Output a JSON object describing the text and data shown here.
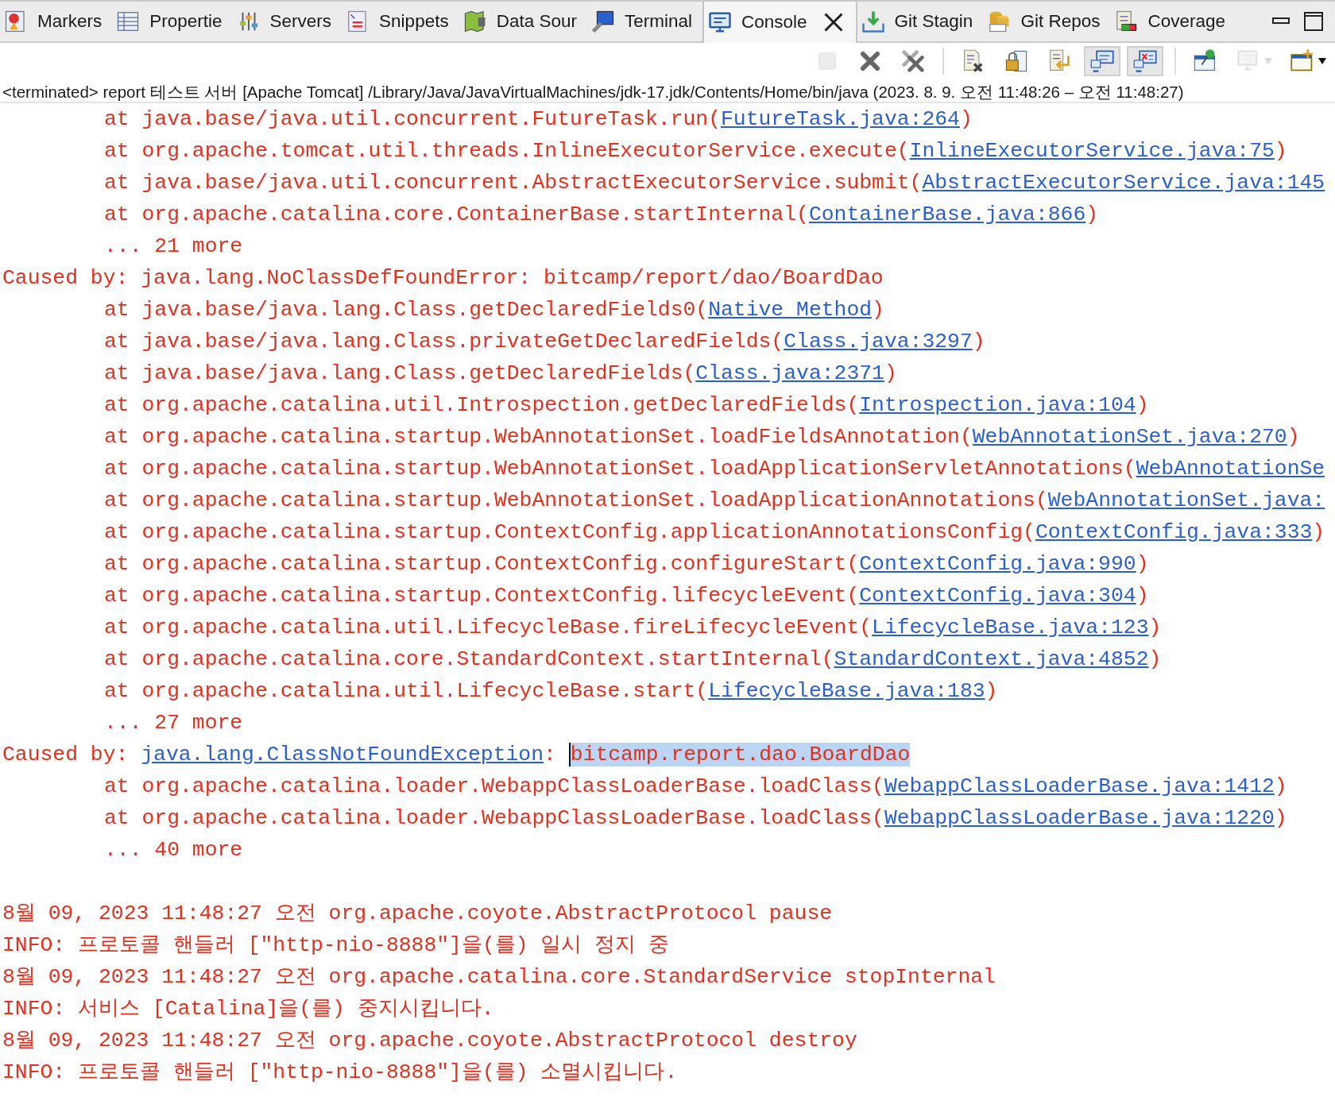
{
  "tabs": [
    {
      "label": "Markers",
      "kind": "markers",
      "selected": false,
      "closable": false
    },
    {
      "label": "Propertie",
      "kind": "table",
      "selected": false,
      "closable": false
    },
    {
      "label": "Servers",
      "kind": "sliders",
      "selected": false,
      "closable": false
    },
    {
      "label": "Snippets",
      "kind": "snippets",
      "selected": false,
      "closable": false
    },
    {
      "label": "Data Sour",
      "kind": "map",
      "selected": false,
      "closable": false
    },
    {
      "label": "Terminal",
      "kind": "terminal",
      "selected": false,
      "closable": false
    },
    {
      "label": "Console",
      "kind": "monitor",
      "selected": true,
      "closable": true
    },
    {
      "label": "Git Stagin",
      "kind": "staging",
      "selected": false,
      "closable": false
    },
    {
      "label": "Git Repos",
      "kind": "repos",
      "selected": false,
      "closable": false
    },
    {
      "label": "Coverage",
      "kind": "coverage",
      "selected": false,
      "closable": false
    }
  ],
  "toolbar": [
    {
      "kind": "stop",
      "disabled": true,
      "pressed": false,
      "menu": false
    },
    {
      "kind": "remove",
      "disabled": false,
      "pressed": false,
      "menu": false
    },
    {
      "kind": "remove-all",
      "disabled": false,
      "pressed": false,
      "menu": false
    },
    {
      "kind": "separator"
    },
    {
      "kind": "clear",
      "disabled": false,
      "pressed": false,
      "menu": false
    },
    {
      "kind": "scroll-lock",
      "disabled": false,
      "pressed": false,
      "menu": false
    },
    {
      "kind": "word-wrap",
      "disabled": false,
      "pressed": false,
      "menu": false
    },
    {
      "kind": "show-stdout",
      "disabled": false,
      "pressed": true,
      "menu": false
    },
    {
      "kind": "show-stderr",
      "disabled": false,
      "pressed": true,
      "menu": false
    },
    {
      "kind": "separator"
    },
    {
      "kind": "pin",
      "disabled": false,
      "pressed": false,
      "menu": false
    },
    {
      "kind": "display",
      "disabled": true,
      "pressed": false,
      "menu": true
    },
    {
      "kind": "new-console",
      "disabled": false,
      "pressed": false,
      "menu": true
    }
  ],
  "process_label": "<terminated> report 테스트 서버 [Apache Tomcat] /Library/Java/JavaVirtualMachines/jdk-17.jdk/Contents/Home/bin/java  (2023. 8. 9. 오전 11:48:26 – 오전 11:48:27)",
  "console_lines": [
    {
      "kind": "frame",
      "segments": [
        {
          "kind": "text",
          "text": "at java.base/java.util.concurrent.FutureTask.run("
        },
        {
          "kind": "link",
          "text": "FutureTask.java:264"
        },
        {
          "kind": "text",
          "text": ")"
        }
      ]
    },
    {
      "kind": "frame",
      "segments": [
        {
          "kind": "text",
          "text": "at org.apache.tomcat.util.threads.InlineExecutorService.execute("
        },
        {
          "kind": "link",
          "text": "InlineExecutorService.java:75"
        },
        {
          "kind": "text",
          "text": ")"
        }
      ]
    },
    {
      "kind": "frame",
      "segments": [
        {
          "kind": "text",
          "text": "at java.base/java.util.concurrent.AbstractExecutorService.submit("
        },
        {
          "kind": "link",
          "text": "AbstractExecutorService.java:145"
        }
      ]
    },
    {
      "kind": "frame",
      "segments": [
        {
          "kind": "text",
          "text": "at org.apache.catalina.core.ContainerBase.startInternal("
        },
        {
          "kind": "link",
          "text": "ContainerBase.java:866"
        },
        {
          "kind": "text",
          "text": ")"
        }
      ]
    },
    {
      "kind": "frame",
      "segments": [
        {
          "kind": "text",
          "text": "... 21 more"
        }
      ]
    },
    {
      "kind": "plain",
      "segments": [
        {
          "kind": "text",
          "text": "Caused by: java.lang.NoClassDefFoundError: bitcamp/report/dao/BoardDao"
        }
      ]
    },
    {
      "kind": "frame",
      "segments": [
        {
          "kind": "text",
          "text": "at java.base/java.lang.Class.getDeclaredFields0("
        },
        {
          "kind": "link",
          "text": "Native Method"
        },
        {
          "kind": "text",
          "text": ")"
        }
      ]
    },
    {
      "kind": "frame",
      "segments": [
        {
          "kind": "text",
          "text": "at java.base/java.lang.Class.privateGetDeclaredFields("
        },
        {
          "kind": "link",
          "text": "Class.java:3297"
        },
        {
          "kind": "text",
          "text": ")"
        }
      ]
    },
    {
      "kind": "frame",
      "segments": [
        {
          "kind": "text",
          "text": "at java.base/java.lang.Class.getDeclaredFields("
        },
        {
          "kind": "link",
          "text": "Class.java:2371"
        },
        {
          "kind": "text",
          "text": ")"
        }
      ]
    },
    {
      "kind": "frame",
      "segments": [
        {
          "kind": "text",
          "text": "at org.apache.catalina.util.Introspection.getDeclaredFields("
        },
        {
          "kind": "link",
          "text": "Introspection.java:104"
        },
        {
          "kind": "text",
          "text": ")"
        }
      ]
    },
    {
      "kind": "frame",
      "segments": [
        {
          "kind": "text",
          "text": "at org.apache.catalina.startup.WebAnnotationSet.loadFieldsAnnotation("
        },
        {
          "kind": "link",
          "text": "WebAnnotationSet.java:270"
        },
        {
          "kind": "text",
          "text": ")"
        }
      ]
    },
    {
      "kind": "frame",
      "segments": [
        {
          "kind": "text",
          "text": "at org.apache.catalina.startup.WebAnnotationSet.loadApplicationServletAnnotations("
        },
        {
          "kind": "link",
          "text": "WebAnnotationSe"
        }
      ]
    },
    {
      "kind": "frame",
      "segments": [
        {
          "kind": "text",
          "text": "at org.apache.catalina.startup.WebAnnotationSet.loadApplicationAnnotations("
        },
        {
          "kind": "link",
          "text": "WebAnnotationSet.java:"
        }
      ]
    },
    {
      "kind": "frame",
      "segments": [
        {
          "kind": "text",
          "text": "at org.apache.catalina.startup.ContextConfig.applicationAnnotationsConfig("
        },
        {
          "kind": "link",
          "text": "ContextConfig.java:333"
        },
        {
          "kind": "text",
          "text": ")"
        }
      ]
    },
    {
      "kind": "frame",
      "segments": [
        {
          "kind": "text",
          "text": "at org.apache.catalina.startup.ContextConfig.configureStart("
        },
        {
          "kind": "link",
          "text": "ContextConfig.java:990"
        },
        {
          "kind": "text",
          "text": ")"
        }
      ]
    },
    {
      "kind": "frame",
      "segments": [
        {
          "kind": "text",
          "text": "at org.apache.catalina.startup.ContextConfig.lifecycleEvent("
        },
        {
          "kind": "link",
          "text": "ContextConfig.java:304"
        },
        {
          "kind": "text",
          "text": ")"
        }
      ]
    },
    {
      "kind": "frame",
      "segments": [
        {
          "kind": "text",
          "text": "at org.apache.catalina.util.LifecycleBase.fireLifecycleEvent("
        },
        {
          "kind": "link",
          "text": "LifecycleBase.java:123"
        },
        {
          "kind": "text",
          "text": ")"
        }
      ]
    },
    {
      "kind": "frame",
      "segments": [
        {
          "kind": "text",
          "text": "at org.apache.catalina.core.StandardContext.startInternal("
        },
        {
          "kind": "link",
          "text": "StandardContext.java:4852"
        },
        {
          "kind": "text",
          "text": ")"
        }
      ]
    },
    {
      "kind": "frame",
      "segments": [
        {
          "kind": "text",
          "text": "at org.apache.catalina.util.LifecycleBase.start("
        },
        {
          "kind": "link",
          "text": "LifecycleBase.java:183"
        },
        {
          "kind": "text",
          "text": ")"
        }
      ]
    },
    {
      "kind": "frame",
      "segments": [
        {
          "kind": "text",
          "text": "... 27 more"
        }
      ]
    },
    {
      "kind": "plain",
      "segments": [
        {
          "kind": "text",
          "text": "Caused by: "
        },
        {
          "kind": "link",
          "text": "java.lang.ClassNotFoundException"
        },
        {
          "kind": "text",
          "text": ": "
        },
        {
          "kind": "selection",
          "text": "bitcamp.report.dao.BoardDao"
        }
      ]
    },
    {
      "kind": "frame",
      "segments": [
        {
          "kind": "text",
          "text": "at org.apache.catalina.loader.WebappClassLoaderBase.loadClass("
        },
        {
          "kind": "link",
          "text": "WebappClassLoaderBase.java:1412"
        },
        {
          "kind": "text",
          "text": ")"
        }
      ]
    },
    {
      "kind": "frame",
      "segments": [
        {
          "kind": "text",
          "text": "at org.apache.catalina.loader.WebappClassLoaderBase.loadClass("
        },
        {
          "kind": "link",
          "text": "WebappClassLoaderBase.java:1220"
        },
        {
          "kind": "text",
          "text": ")"
        }
      ]
    },
    {
      "kind": "frame",
      "segments": [
        {
          "kind": "text",
          "text": "... 40 more"
        }
      ]
    },
    {
      "kind": "blank"
    },
    {
      "kind": "plain",
      "segments": [
        {
          "kind": "text",
          "text": "8월 09, 2023 11:48:27 오전 org.apache.coyote.AbstractProtocol pause"
        }
      ]
    },
    {
      "kind": "plain",
      "segments": [
        {
          "kind": "text",
          "text": "INFO: 프로토콜 핸들러 [\"http-nio-8888\"]을(를) 일시 정지 중"
        }
      ]
    },
    {
      "kind": "plain",
      "segments": [
        {
          "kind": "text",
          "text": "8월 09, 2023 11:48:27 오전 org.apache.catalina.core.StandardService stopInternal"
        }
      ]
    },
    {
      "kind": "plain",
      "segments": [
        {
          "kind": "text",
          "text": "INFO: 서비스 [Catalina]을(를) 중지시킵니다."
        }
      ]
    },
    {
      "kind": "plain",
      "segments": [
        {
          "kind": "text",
          "text": "8월 09, 2023 11:48:27 오전 org.apache.coyote.AbstractProtocol destroy"
        }
      ]
    },
    {
      "kind": "plain",
      "segments": [
        {
          "kind": "text",
          "text": "INFO: 프로토콜 핸들러 [\"http-nio-8888\"]을(를) 소멸시킵니다."
        }
      ]
    }
  ]
}
